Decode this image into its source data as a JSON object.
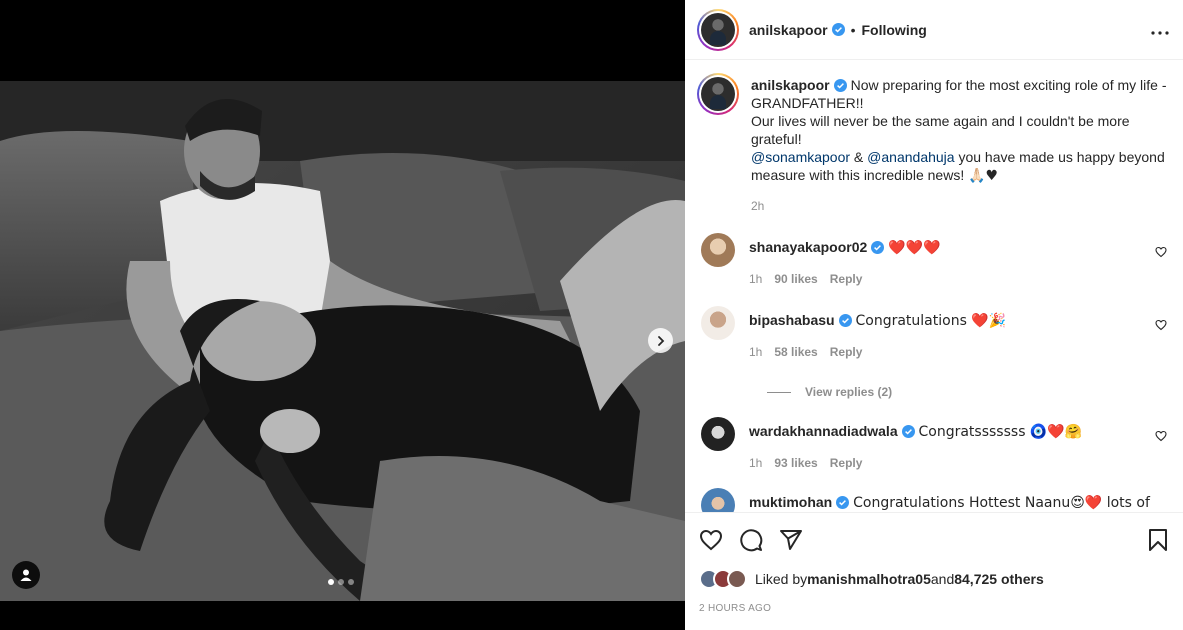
{
  "post": {
    "username": "anilskapoor",
    "follow_status": "Following",
    "bullet": "•",
    "more_icon": "more-horizontal-icon",
    "caption": {
      "line1": "Now preparing for the most exciting role of my life - GRANDFATHER!!",
      "line2": "Our lives will never be the same again and I couldn't be more grateful!",
      "mention1": "@sonamkapoor",
      "amp": " & ",
      "mention2": "@anandahuja",
      "line3": " you have made us happy beyond measure with this incredible news! ",
      "line3_emoji": "🙏🏻♥"
    },
    "caption_time": "2h"
  },
  "comments": [
    {
      "username": "shanayakapoor02",
      "text": "❤️❤️❤️",
      "time": "1h",
      "likes": "90 likes",
      "reply": "Reply"
    },
    {
      "username": "bipashabasu",
      "text": "Congratulations ❤️🎉",
      "time": "1h",
      "likes": "58 likes",
      "reply": "Reply"
    },
    {
      "username": "wardakhannadiadwala",
      "text": "Congratsssssss 🧿❤️🤗",
      "time": "1h",
      "likes": "93 likes",
      "reply": "Reply"
    },
    {
      "username": "muktimohan",
      "text": "Congratulations Hottest Naanu😍❤️ lots of"
    }
  ],
  "view_replies": "View replies (2)",
  "likes_summary": {
    "prefix": "Liked by ",
    "user": "manishmalhotra05",
    "and": " and ",
    "count": "84,725 others"
  },
  "posted_ago": "2 HOURS AGO",
  "icons": {
    "like": "heart-icon",
    "comment": "comment-icon",
    "share": "share-icon",
    "save": "bookmark-icon",
    "next": "chevron-right-icon",
    "tag": "user-tag-icon"
  },
  "colors": {
    "mention": "#00376b",
    "verified": "#3897f0",
    "meta": "#8e8e8e"
  },
  "carousel": {
    "total": 3,
    "current": 1
  }
}
